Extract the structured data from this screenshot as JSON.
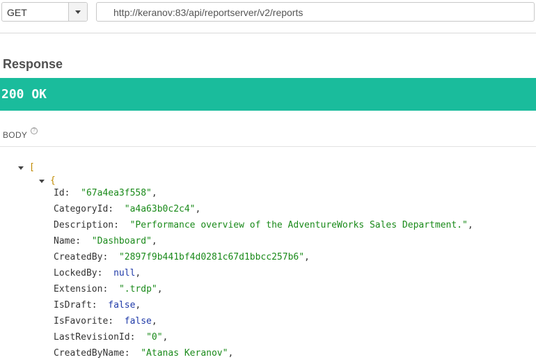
{
  "request": {
    "method": "GET",
    "url": "http://keranov:83/api/reportserver/v2/reports"
  },
  "response": {
    "title": "Response",
    "status": "200 OK",
    "body_label": "BODY",
    "help_glyph": "?"
  },
  "json": {
    "open_array": "[",
    "open_object": "{",
    "rows": [
      {
        "key": "Id:",
        "value": "\"67a4ea3f558\"",
        "type": "string",
        "comma": ","
      },
      {
        "key": "CategoryId:",
        "value": "\"a4a63b0c2c4\"",
        "type": "string",
        "comma": ","
      },
      {
        "key": "Description:",
        "value": "\"Performance overview of the AdventureWorks Sales Department.\"",
        "type": "string",
        "comma": ","
      },
      {
        "key": "Name:",
        "value": "\"Dashboard\"",
        "type": "string",
        "comma": ","
      },
      {
        "key": "CreatedBy:",
        "value": "\"2897f9b441bf4d0281c67d1bbcc257b6\"",
        "type": "string",
        "comma": ","
      },
      {
        "key": "LockedBy:",
        "value": "null",
        "type": "null",
        "comma": ","
      },
      {
        "key": "Extension:",
        "value": "\".trdp\"",
        "type": "string",
        "comma": ","
      },
      {
        "key": "IsDraft:",
        "value": "false",
        "type": "bool",
        "comma": ","
      },
      {
        "key": "IsFavorite:",
        "value": "false",
        "type": "bool",
        "comma": ","
      },
      {
        "key": "LastRevisionId:",
        "value": "\"0\"",
        "type": "string",
        "comma": ","
      },
      {
        "key": "CreatedByName:",
        "value": "\"Atanas Keranov\"",
        "type": "string",
        "comma": ","
      }
    ]
  },
  "colors": {
    "status_bg": "#1abc9c",
    "string": "#1a8a1a",
    "literal": "#1f3aa8",
    "bracket": "#c08a00"
  }
}
